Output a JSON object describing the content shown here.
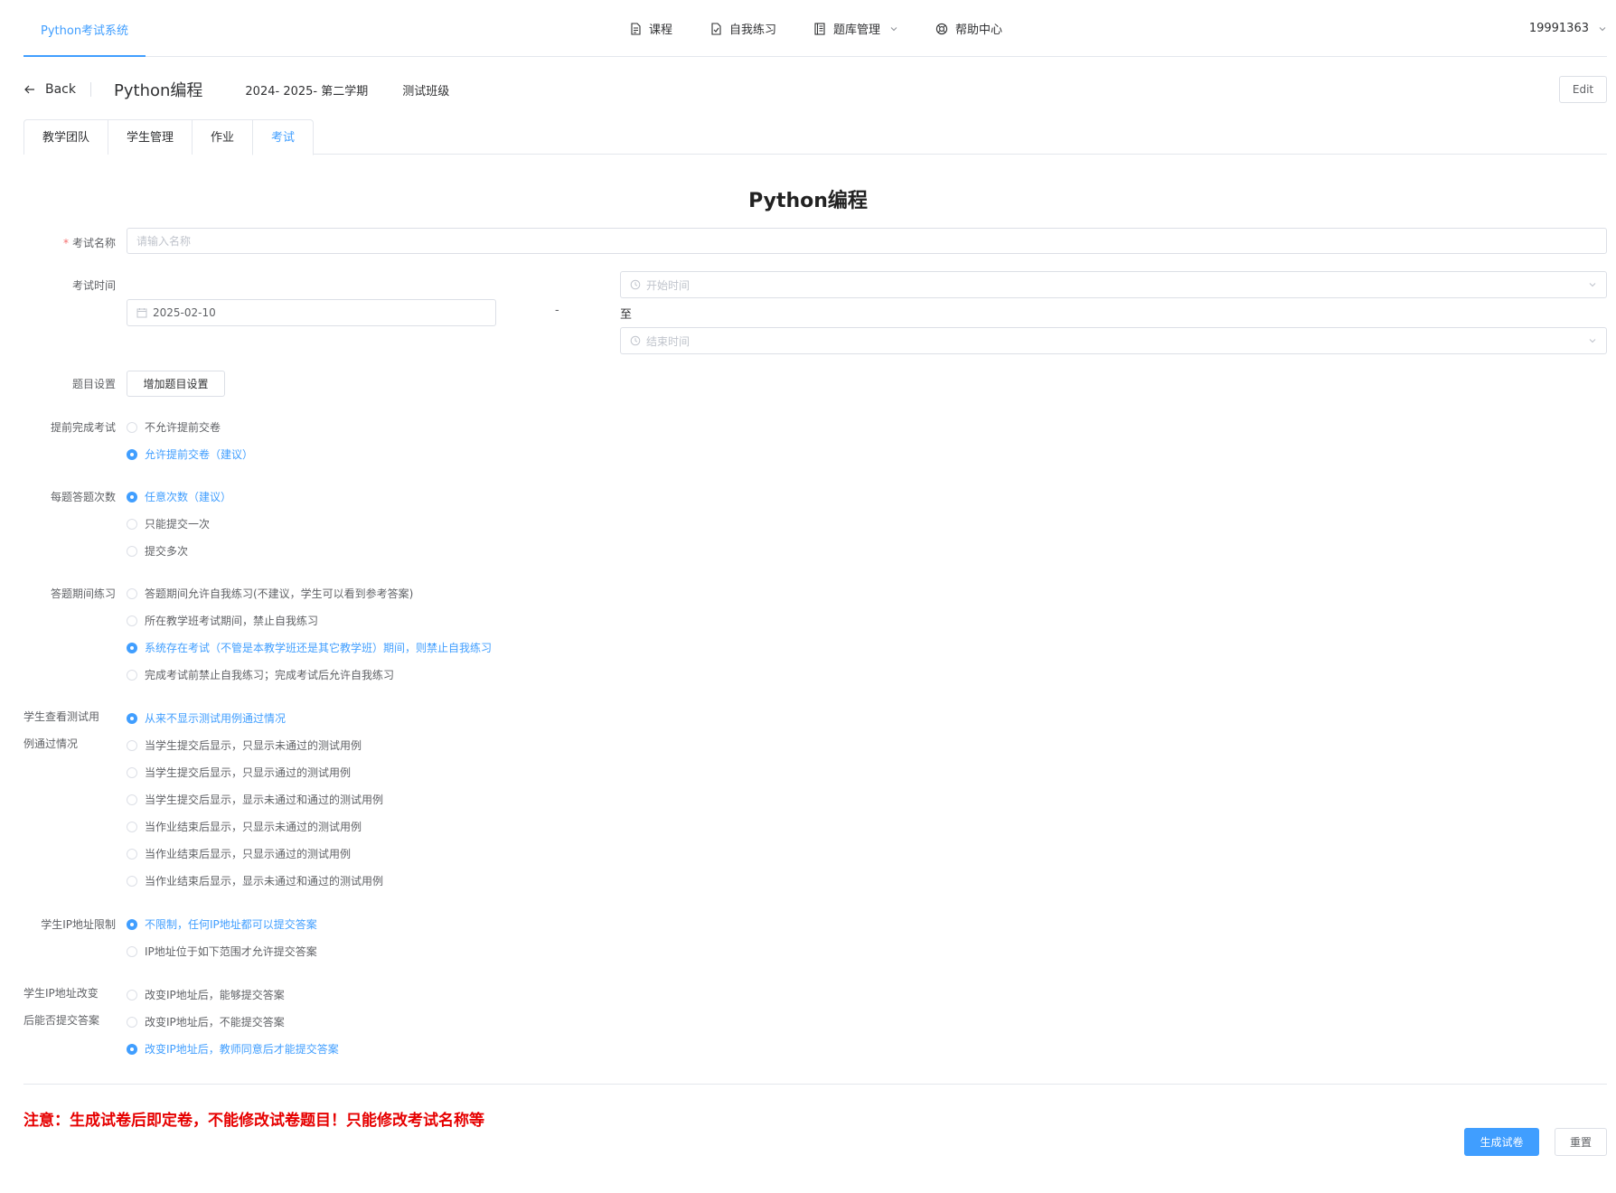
{
  "nav": {
    "brand": "Python考试系统",
    "items": [
      {
        "label": "课程",
        "icon": "document-icon"
      },
      {
        "label": "自我练习",
        "icon": "check-document-icon"
      },
      {
        "label": "题库管理",
        "icon": "book-icon"
      },
      {
        "label": "帮助中心",
        "icon": "lifebuoy-icon"
      }
    ],
    "user": "19991363"
  },
  "header": {
    "back_label": "Back",
    "course_title": "Python编程",
    "term": "2024- 2025- 第二学期",
    "class_name": "测试班级",
    "edit_label": "Edit"
  },
  "tabs": [
    {
      "label": "教学团队"
    },
    {
      "label": "学生管理"
    },
    {
      "label": "作业"
    },
    {
      "label": "考试",
      "active": true
    }
  ],
  "form": {
    "title": "Python编程",
    "exam_name_label": "考试名称",
    "exam_name_placeholder": "请输入名称",
    "exam_time_label": "考试时间",
    "date_value": "2025-02-10",
    "dash": "-",
    "to_label": "至",
    "start_time_placeholder": "开始时间",
    "end_time_placeholder": "结束时间",
    "question_setting_label": "题目设置",
    "add_question_setting": "增加题目设置",
    "early_finish": {
      "label": "提前完成考试",
      "options": [
        "不允许提前交卷",
        "允许提前交卷（建议）"
      ],
      "selected": 1
    },
    "attempts": {
      "label": "每题答题次数",
      "options": [
        "任意次数（建议）",
        "只能提交一次",
        "提交多次"
      ],
      "selected": 0
    },
    "practice": {
      "label": "答题期间练习",
      "options": [
        "答题期间允许自我练习(不建议，学生可以看到参考答案)",
        "所在教学班考试期间，禁止自我练习",
        "系统存在考试（不管是本教学班还是其它教学班）期间，则禁止自我练习",
        "完成考试前禁止自我练习；完成考试后允许自我练习"
      ],
      "selected": 2
    },
    "testcases": {
      "label_line1": "学生查看测试用",
      "label_line2": "例通过情况",
      "options": [
        "从来不显示测试用例通过情况",
        "当学生提交后显示，只显示未通过的测试用例",
        "当学生提交后显示，只显示通过的测试用例",
        "当学生提交后显示，显示未通过和通过的测试用例",
        "当作业结束后显示，只显示未通过的测试用例",
        "当作业结束后显示，只显示通过的测试用例",
        "当作业结束后显示，显示未通过和通过的测试用例"
      ],
      "selected": 0
    },
    "ip_limit": {
      "label": "学生IP地址限制",
      "options": [
        "不限制，任何IP地址都可以提交答案",
        "IP地址位于如下范围才允许提交答案"
      ],
      "selected": 0
    },
    "ip_change": {
      "label_line1": "学生IP地址改变",
      "label_line2": "后能否提交答案",
      "options": [
        "改变IP地址后，能够提交答案",
        "改变IP地址后，不能提交答案",
        "改变IP地址后，教师同意后才能提交答案"
      ],
      "selected": 2
    }
  },
  "footer": {
    "notice": "注意：生成试卷后即定卷，不能修改试卷题目！只能修改考试名称等",
    "generate_label": "生成试卷",
    "reset_label": "重置"
  },
  "colors": {
    "accent": "#409eff",
    "warning": "#e60000"
  }
}
